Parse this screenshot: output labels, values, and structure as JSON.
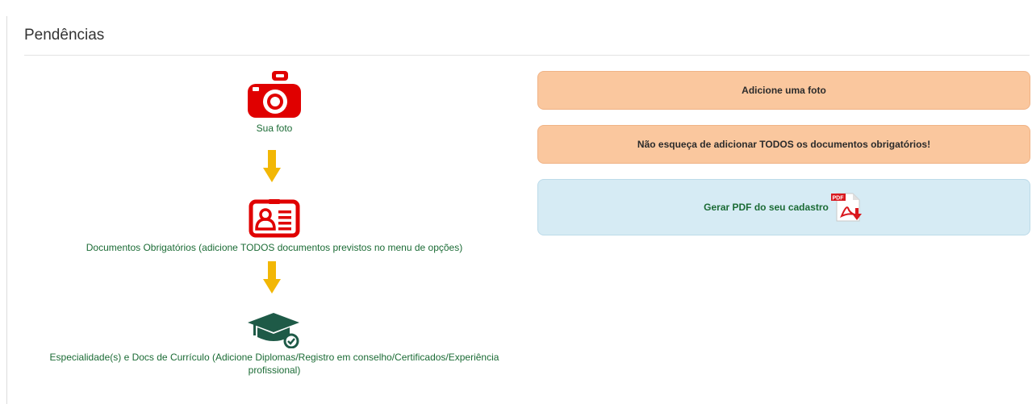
{
  "header": {
    "title": "Pendências"
  },
  "steps": [
    {
      "label": "Sua foto",
      "icon": "camera-icon",
      "color": "#e00000"
    },
    {
      "label": "Documentos Obrigatórios (adicione TODOS documentos previstos no menu de opções)",
      "icon": "id-card-icon",
      "color": "#e00000"
    },
    {
      "label": "Especialidade(s) e Docs de Currículo (Adicione Diplomas/Registro em conselho/Certificados/Experiência",
      "label_line2": "profissional)",
      "icon": "graduation-cap-icon",
      "color": "#1e5a47"
    }
  ],
  "arrows": {
    "icon": "arrow-down-icon",
    "color": "#f2b705"
  },
  "actions": {
    "add_photo": "Adicione uma foto",
    "docs_warning": "Não esqueça de adicionar TODOS os documentos obrigatórios!",
    "generate_pdf": "Gerar PDF do seu cadastro",
    "pdf_icon": "pdf-download-icon",
    "pdf_badge": "PDF"
  },
  "colors": {
    "warning_bg": "#fac79e",
    "info_bg": "#d6ebf4",
    "link_text": "#1b6b35"
  }
}
